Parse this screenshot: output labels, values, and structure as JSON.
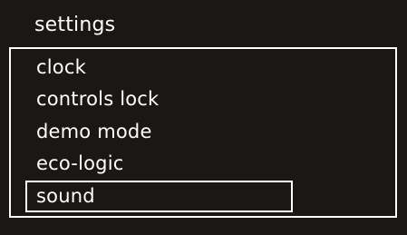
{
  "title": "settings",
  "menu": {
    "items": [
      {
        "label": "clock"
      },
      {
        "label": "controls lock"
      },
      {
        "label": "demo mode"
      },
      {
        "label": "eco-logic"
      },
      {
        "label": "sound",
        "selected": true
      }
    ]
  },
  "colors": {
    "background": "#1a1715",
    "text": "#ffffff",
    "border": "#ffffff"
  }
}
